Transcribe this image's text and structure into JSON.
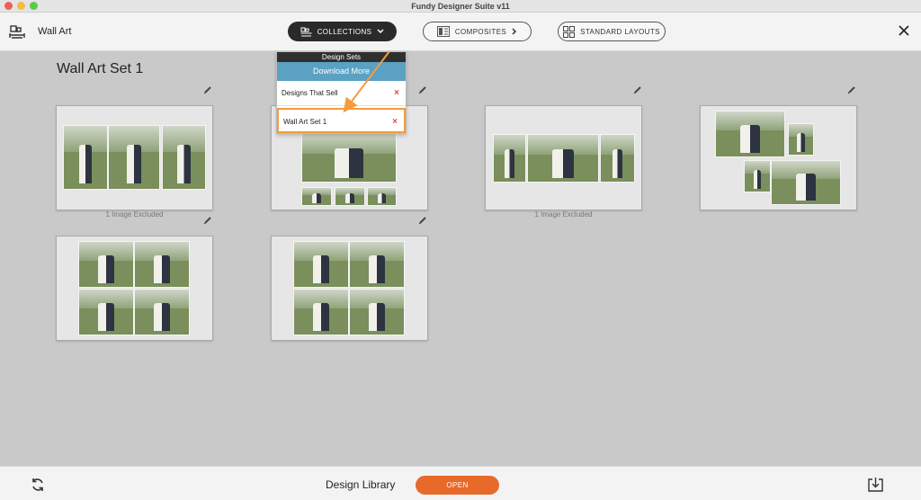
{
  "window": {
    "title": "Fundy Designer Suite v11"
  },
  "toolbar": {
    "section_label": "Wall Art",
    "collections_label": "COLLECTIONS",
    "composites_label": "COMPOSITES",
    "standard_layouts_label": "STANDARD LAYOUTS"
  },
  "main": {
    "section_title": "Wall Art Set 1",
    "cards": [
      {
        "excluded": "1 Image Excluded"
      },
      {
        "excluded": ""
      },
      {
        "excluded": "1 Image Excluded"
      },
      {
        "excluded": ""
      },
      {
        "excluded": ""
      },
      {
        "excluded": ""
      }
    ]
  },
  "dropdown": {
    "header": "Design Sets",
    "download_label": "Download More",
    "items": [
      {
        "label": "Designs That Sell",
        "remove": "×"
      },
      {
        "label": "Wall Art Set 1",
        "remove": "×"
      }
    ]
  },
  "bottombar": {
    "library_label": "Design Library",
    "open_label": "OPEN"
  },
  "colors": {
    "accent_orange": "#e86a2b",
    "selection_outline": "#f39c3e",
    "download_blue": "#5aa1c4"
  },
  "icons": [
    "wall-art-icon",
    "chevron-down-icon",
    "composites-icon",
    "chevron-right-icon",
    "grid-icon",
    "close-icon",
    "pencil-icon",
    "refresh-icon",
    "export-icon",
    "remove-icon"
  ]
}
